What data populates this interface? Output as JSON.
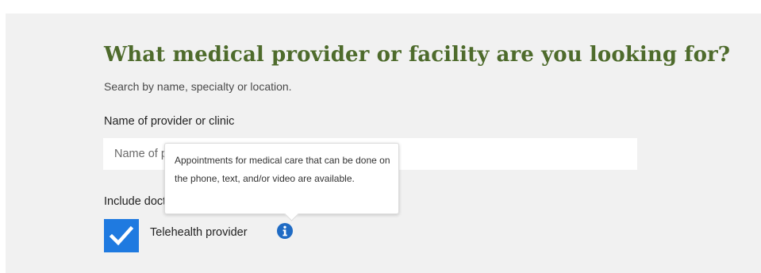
{
  "search": {
    "heading": "What medical provider or facility are you looking for?",
    "subtext": "Search by name, specialty or location.",
    "name_label": "Name of provider or clinic",
    "name_placeholder": "Name of provider or clinic",
    "include_label": "Include doctors available by video or phone",
    "telehealth": {
      "label": "Telehealth provider",
      "checked": true
    }
  },
  "tooltip": {
    "text": "Appointments for medical care that can be done on the phone, text, and/or video are available."
  },
  "icons": {
    "checkbox": "checkmark-icon",
    "info": "info-icon"
  },
  "colors": {
    "heading": "#4e6b2c",
    "panel_bg": "#f1f1f1",
    "checkbox_bg": "#1f7ae0",
    "info_icon": "#1f6bc4"
  }
}
